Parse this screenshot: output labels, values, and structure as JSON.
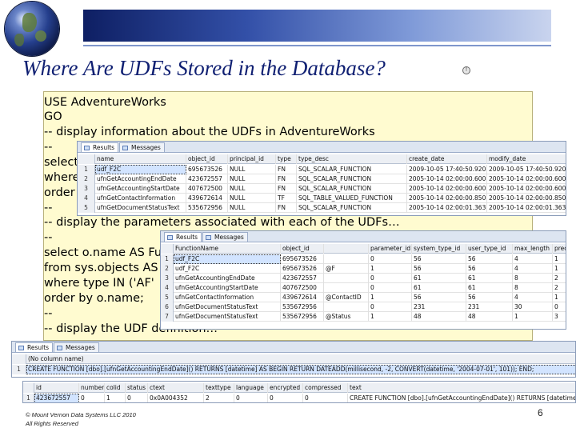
{
  "slide": {
    "title": "Where Are UDFs Stored in the Database?",
    "title_badge": "!",
    "copyright": "© Mount Vernon Data Systems LLC 2010",
    "rights": "All Rights Reserved",
    "page_number": "6"
  },
  "code": {
    "lines": [
      "USE AdventureWorks",
      "GO",
      "-- display information about the UDFs in AdventureWorks",
      "--",
      "select",
      " where",
      " order",
      "--",
      "-- display the parameters associated with each of the UDFs…",
      "--",
      "select o.name AS Fur",
      "  from sys.objects AS",
      " where type IN ('AF'",
      " order by o.name;",
      "--",
      "-- display the UDF definition…"
    ]
  },
  "grid1": {
    "tabs": [
      "Results",
      "Messages"
    ],
    "columns": [
      "name",
      "object_id",
      "principal_id",
      "type",
      "type_desc",
      "create_date",
      "modify_date"
    ],
    "rows": [
      [
        "udf_F2C",
        "695673526",
        "NULL",
        "FN",
        "SQL_SCALAR_FUNCTION",
        "2009-10-05 17:40:50.920",
        "2009-10-05 17:40:50.920"
      ],
      [
        "ufnGetAccountingEndDate",
        "423672557",
        "NULL",
        "FN",
        "SQL_SCALAR_FUNCTION",
        "2005-10-14 02:00:00.600",
        "2005-10-14 02:00:00.600"
      ],
      [
        "ufnGetAccountingStartDate",
        "407672500",
        "NULL",
        "FN",
        "SQL_SCALAR_FUNCTION",
        "2005-10-14 02:00:00.600",
        "2005-10-14 02:00:00.600"
      ],
      [
        "ufnGetContactInformation",
        "439672614",
        "NULL",
        "TF",
        "SQL_TABLE_VALUED_FUNCTION",
        "2005-10-14 02:00:00.850",
        "2005-10-14 02:00:00.850"
      ],
      [
        "ufnGetDocumentStatusText",
        "535672956",
        "NULL",
        "FN",
        "SQL_SCALAR_FUNCTION",
        "2005-10-14 02:00:01.363",
        "2005-10-14 02:00:01.363"
      ]
    ]
  },
  "grid2": {
    "tabs": [
      "Results",
      "Messages"
    ],
    "columns": [
      "FunctionName",
      "object_id",
      "",
      "parameter_id",
      "system_type_id",
      "user_type_id",
      "max_length",
      "precision"
    ],
    "rows": [
      [
        "1",
        "udf_F2C",
        "695673526",
        "",
        "0",
        "56",
        "56",
        "4",
        "1"
      ],
      [
        "2",
        "udf_F2C",
        "695673526",
        "@F",
        "1",
        "56",
        "56",
        "4",
        "1"
      ],
      [
        "3",
        "ufnGetAccountingEndDate",
        "423672557",
        "",
        "0",
        "61",
        "61",
        "8",
        "2"
      ],
      [
        "4",
        "ufnGetAccountingStartDate",
        "407672500",
        "",
        "0",
        "61",
        "61",
        "8",
        "2"
      ],
      [
        "5",
        "ufnGetContactInformation",
        "439672614",
        "@ContactID",
        "1",
        "56",
        "56",
        "4",
        "1"
      ],
      [
        "6",
        "ufnGetDocumentStatusText",
        "535672956",
        "",
        "0",
        "231",
        "231",
        "30",
        "0"
      ],
      [
        "7",
        "ufnGetDocumentStatusText",
        "535672956",
        "@Status",
        "1",
        "48",
        "48",
        "1",
        "3"
      ]
    ]
  },
  "grid3": {
    "tabs": [
      "Results",
      "Messages"
    ],
    "header": "(No column name)",
    "row_number": "1",
    "row_text": "CREATE FUNCTION [dbo].[ufnGetAccountingEndDate]() RETURNS [datetime] AS BEGIN RETURN DATEADD(millisecond, -2, CONVERT(datetime, '2004-07-01', 101)); END;"
  },
  "grid4": {
    "columns": [
      "id",
      "number",
      "colid",
      "status",
      "ctext",
      "texttype",
      "language",
      "encrypted",
      "compressed",
      "text"
    ],
    "rows": [
      [
        "1",
        "423672557",
        "0",
        "1",
        "0",
        "0x0A004352",
        "2",
        "0",
        "0",
        "0",
        "CREATE FUNCTION [dbo].[ufnGetAccountingEndDate]() RETURNS [datetime]"
      ]
    ]
  },
  "colors": {
    "title": "#0f1f72",
    "code_background": "#fffbd0",
    "selection": "#d2e4ff"
  }
}
